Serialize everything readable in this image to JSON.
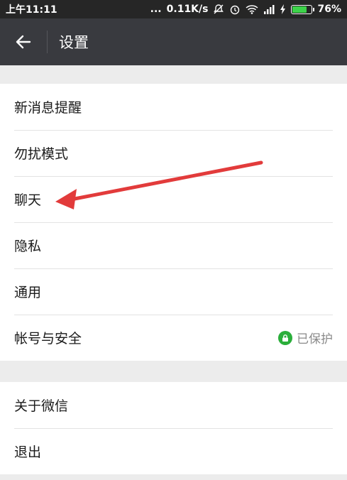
{
  "status_bar": {
    "time": "上午11:11",
    "dots": "...",
    "network_speed": "0.11K/s",
    "battery_percent": "76%",
    "battery_level": 0.76,
    "icons": [
      "mute-icon",
      "alarm-icon",
      "wifi-icon",
      "signal-icon",
      "charging-icon",
      "battery-icon"
    ]
  },
  "header": {
    "title": "设置",
    "back_icon": "arrow-left-icon"
  },
  "settings_group_1": [
    {
      "label": "新消息提醒"
    },
    {
      "label": "勿扰模式"
    },
    {
      "label": "聊天"
    },
    {
      "label": "隐私"
    },
    {
      "label": "通用"
    },
    {
      "label": "帐号与安全",
      "status": "已保护",
      "status_icon": "lock-icon"
    }
  ],
  "settings_group_2": [
    {
      "label": "关于微信"
    },
    {
      "label": "退出"
    }
  ],
  "colors": {
    "status_bar_bg": "#262626",
    "title_bar_bg": "#393a3f",
    "page_bg": "#ececec",
    "lock_badge": "#2aae3a",
    "annotation_arrow": "#e23b3b"
  }
}
